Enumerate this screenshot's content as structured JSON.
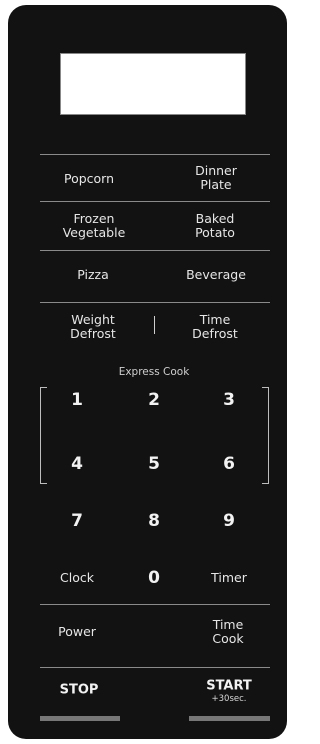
{
  "display": {},
  "row1": {
    "left": "Popcorn",
    "right": [
      "Dinner",
      "Plate"
    ]
  },
  "row2": {
    "left": [
      "Frozen",
      "Vegetable"
    ],
    "right": [
      "Baked",
      "Potato"
    ]
  },
  "row3": {
    "left": "Pizza",
    "right": "Beverage"
  },
  "row4": {
    "left": [
      "Weight",
      "Defrost"
    ],
    "right": [
      "Time",
      "Defrost"
    ]
  },
  "express_cook": "Express Cook",
  "keys": {
    "k1": "1",
    "k2": "2",
    "k3": "3",
    "k4": "4",
    "k5": "5",
    "k6": "6",
    "k7": "7",
    "k8": "8",
    "k9": "9",
    "k0": "0"
  },
  "bottom": {
    "clock": "Clock",
    "timer": "Timer",
    "power": "Power",
    "time_cook": [
      "Time",
      "Cook"
    ],
    "stop": "STOP",
    "start": "START",
    "start_sub": "+30sec."
  }
}
